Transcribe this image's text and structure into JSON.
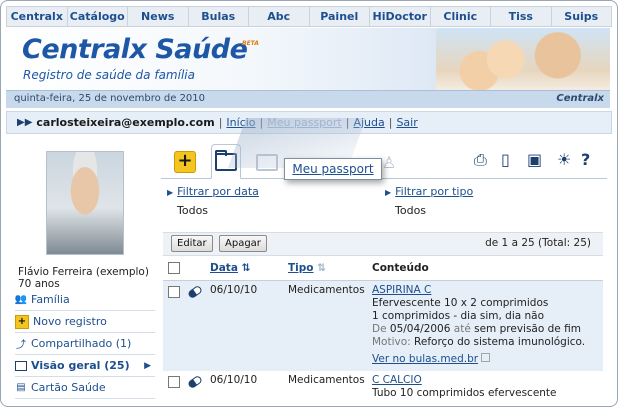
{
  "topnav": [
    "Centralx",
    "Catálogo",
    "News",
    "Bulas",
    "Abc",
    "Painel",
    "HiDoctor",
    "Clinic",
    "Tiss",
    "Suips"
  ],
  "banner": {
    "brand": "Centralx Saúde",
    "beta": "BETA",
    "tagline": "Registro de saúde da família",
    "date": "quinta-feira, 25 de novembro de 2010",
    "logo": "Centralx"
  },
  "userbar": {
    "email": "carlosteixeira@exemplo.com",
    "inicio": "Início",
    "passport": "Meu passport",
    "ajuda": "Ajuda",
    "sair": "Sair"
  },
  "profile": {
    "name": "Flávio Ferreira (exemplo)",
    "age": "70 anos"
  },
  "menu": [
    {
      "label": "Família",
      "icon": "people-icon"
    },
    {
      "label": "Novo registro",
      "icon": "plus-icon"
    },
    {
      "label": "Compartilhado (1)",
      "icon": "share-icon"
    },
    {
      "label": "Visão geral (25)",
      "icon": "folder-icon"
    },
    {
      "label": "Cartão Saúde",
      "icon": "card-icon"
    }
  ],
  "tooltip": "Meu passport",
  "filters": {
    "date_label": "Filtrar por data",
    "date_value": "Todos",
    "type_label": "Filtrar por tipo",
    "type_value": "Todos"
  },
  "toolbar": {
    "edit": "Editar",
    "delete": "Apagar",
    "pager": "de 1 a 25 (Total: 25)"
  },
  "table": {
    "headers": {
      "date": "Data",
      "type": "Tipo",
      "content": "Conteúdo"
    },
    "rows": [
      {
        "date": "06/10/10",
        "type": "Medicamentos",
        "title": "ASPIRINA C",
        "line1": "Efervescente 10 x 2 comprimidos",
        "line2": "1 comprimidos - dia sim, dia não",
        "de_label": "De",
        "de_value": "05/04/2006",
        "ate_label": "até",
        "ate_value": "sem previsão de fim",
        "motivo_label": "Motivo:",
        "motivo_value": "Reforço do sistema imunológico.",
        "link": "Ver no bulas.med.br"
      },
      {
        "date": "06/10/10",
        "type": "Medicamentos",
        "title": "C CALCIO",
        "line1": "Tubo 10 comprimidos efervescente"
      }
    ]
  }
}
